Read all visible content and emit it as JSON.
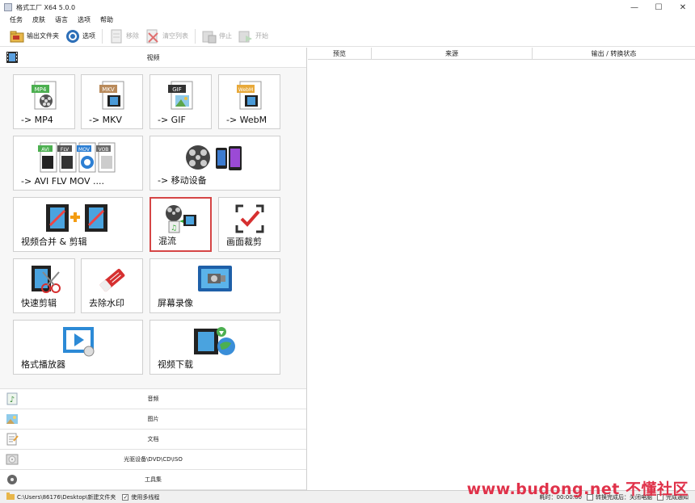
{
  "window": {
    "title": "格式工厂 X64 5.0.0",
    "min": "—",
    "max": "☐",
    "close": "✕"
  },
  "menu": [
    "任务",
    "皮肤",
    "语言",
    "选项",
    "帮助"
  ],
  "toolbar": {
    "output_folder": "输出文件夹",
    "options": "选项",
    "remove": "移除",
    "clear_list": "清空列表",
    "stop": "停止",
    "start": "开始"
  },
  "sections": {
    "video": "视频",
    "audio": "音频",
    "picture": "图片",
    "document": "文档",
    "optical": "光驱设备\\DVD\\CD\\ISO",
    "tools": "工具集"
  },
  "tiles": {
    "mp4": {
      "label": "-> MP4",
      "badge": "MP4"
    },
    "mkv": {
      "label": "-> MKV",
      "badge": "MKV"
    },
    "gif": {
      "label": "-> GIF",
      "badge": "GIF"
    },
    "webm": {
      "label": "-> WebM",
      "badge": "WebM"
    },
    "multi": {
      "label": "-> AVI FLV MOV ....",
      "b1": "AVI",
      "b2": "FLV",
      "b3": "MOV",
      "b4": "VOB"
    },
    "mobile": {
      "label": "-> 移动设备"
    },
    "merge": {
      "label": "视频合并 & 剪辑"
    },
    "mux": {
      "label": "混流"
    },
    "crop": {
      "label": "画面裁剪"
    },
    "quickcut": {
      "label": "快速剪辑"
    },
    "watermark": {
      "label": "去除水印"
    },
    "record": {
      "label": "屏幕录像"
    },
    "player": {
      "label": "格式播放器"
    },
    "download": {
      "label": "视频下载"
    }
  },
  "table": {
    "columns": [
      "预览",
      "来源",
      "输出 / 转换状态"
    ]
  },
  "status": {
    "path": "C:\\Users\\86176\\Desktop\\新建文件夹",
    "multithread": "使用多线程",
    "elapsed": "耗时：00:00:00",
    "after_done": "转换完成后：关闭电脑",
    "notify": "完成通知"
  },
  "watermark_text": "www.budong.net 不懂社区",
  "colors": {
    "selected_border": "#d54545",
    "watermark": "#e0324a"
  }
}
